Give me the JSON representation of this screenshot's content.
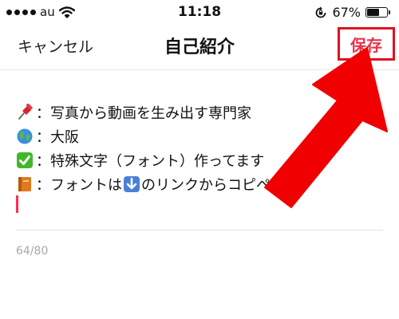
{
  "status_bar": {
    "carrier": "au",
    "time": "11:18",
    "battery_percent_label": "67%",
    "battery_level": 0.67
  },
  "nav": {
    "cancel_label": "キャンセル",
    "title": "自己紹介",
    "save_label": "保存"
  },
  "bio": {
    "lines": [
      {
        "icon": "pushpin-icon",
        "text": "：写真から動画を生み出す専門家"
      },
      {
        "icon": "globe-icon",
        "text": "：大阪"
      },
      {
        "icon": "check-mark-icon",
        "text": "：特殊文字（フォント）作ってます"
      },
      {
        "icon": "book-icon",
        "text_before": "：フォントは",
        "inline_icon": "down-arrow-icon",
        "text_after": "のリンクからコピペ可能"
      }
    ]
  },
  "counter": "64/80",
  "colors": {
    "accent": "#e8334a",
    "highlight_border": "#e01020",
    "arrow": "#f00000",
    "cursor": "#ff2d55"
  }
}
